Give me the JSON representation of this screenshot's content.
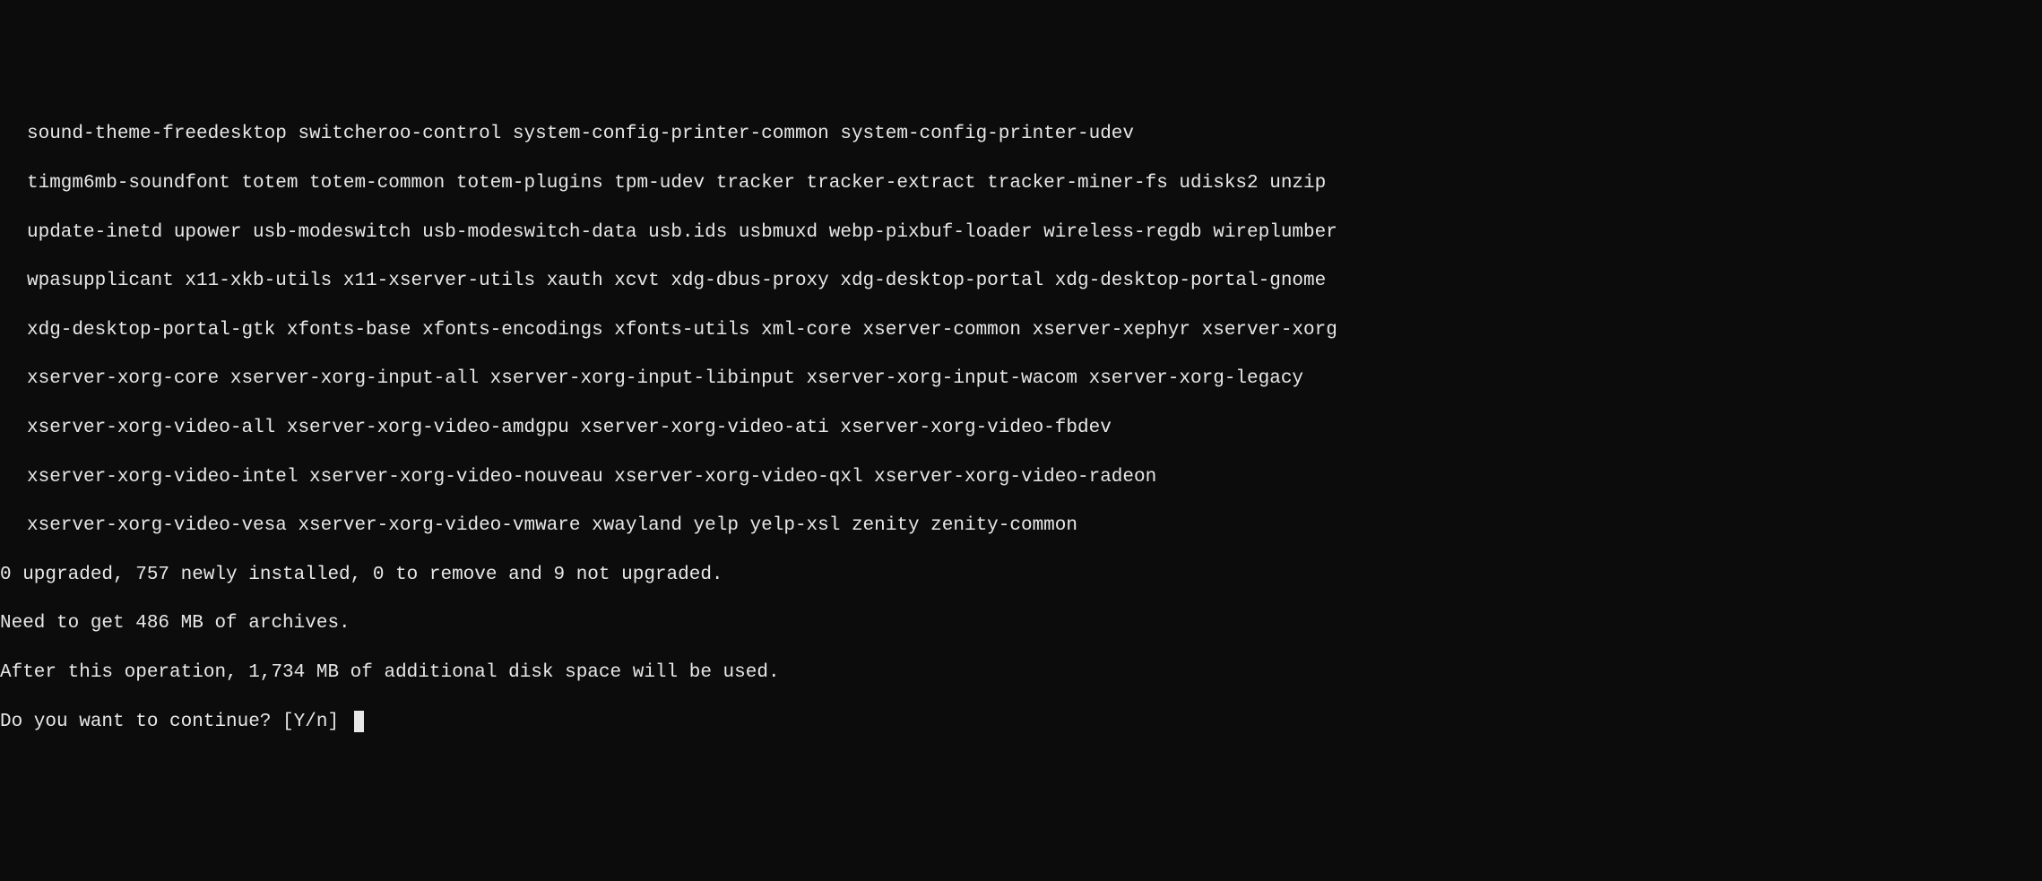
{
  "packages": {
    "line1": "sound-theme-freedesktop switcheroo-control system-config-printer-common system-config-printer-udev",
    "line2": "timgm6mb-soundfont totem totem-common totem-plugins tpm-udev tracker tracker-extract tracker-miner-fs udisks2 unzip",
    "line3": "update-inetd upower usb-modeswitch usb-modeswitch-data usb.ids usbmuxd webp-pixbuf-loader wireless-regdb wireplumber",
    "line4": "wpasupplicant x11-xkb-utils x11-xserver-utils xauth xcvt xdg-dbus-proxy xdg-desktop-portal xdg-desktop-portal-gnome",
    "line5": "xdg-desktop-portal-gtk xfonts-base xfonts-encodings xfonts-utils xml-core xserver-common xserver-xephyr xserver-xorg",
    "line6": "xserver-xorg-core xserver-xorg-input-all xserver-xorg-input-libinput xserver-xorg-input-wacom xserver-xorg-legacy",
    "line7": "xserver-xorg-video-all xserver-xorg-video-amdgpu xserver-xorg-video-ati xserver-xorg-video-fbdev",
    "line8": "xserver-xorg-video-intel xserver-xorg-video-nouveau xserver-xorg-video-qxl xserver-xorg-video-radeon",
    "line9": "xserver-xorg-video-vesa xserver-xorg-video-vmware xwayland yelp yelp-xsl zenity zenity-common"
  },
  "status": {
    "summary": "0 upgraded, 757 newly installed, 0 to remove and 9 not upgraded.",
    "download": "Need to get 486 MB of archives.",
    "diskspace": "After this operation, 1,734 MB of additional disk space will be used."
  },
  "prompt": {
    "text": "Do you want to continue? [Y/n] "
  }
}
